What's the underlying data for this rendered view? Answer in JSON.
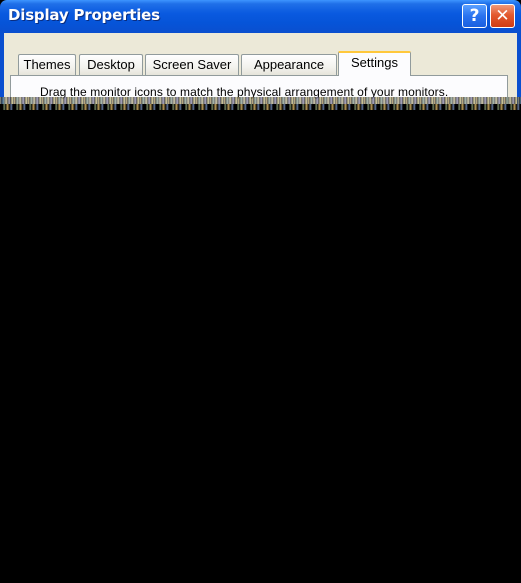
{
  "window": {
    "title": "Display Properties"
  },
  "titlebar": {
    "help_label": "?",
    "close_label": "✕",
    "help_icon": "help-icon",
    "close_icon": "close-icon"
  },
  "tabs": [
    {
      "label": "Themes"
    },
    {
      "label": "Desktop"
    },
    {
      "label": "Screen Saver"
    },
    {
      "label": "Appearance"
    },
    {
      "label": "Settings",
      "active": true
    }
  ],
  "settings": {
    "instruction": "Drag the monitor icons to match the physical arrangement of your monitors."
  },
  "colors": {
    "titlebar_blue": "#0654d8",
    "close_red": "#e35a2f",
    "face": "#ece9d8",
    "active_tab_accent": "#ffc83c"
  }
}
